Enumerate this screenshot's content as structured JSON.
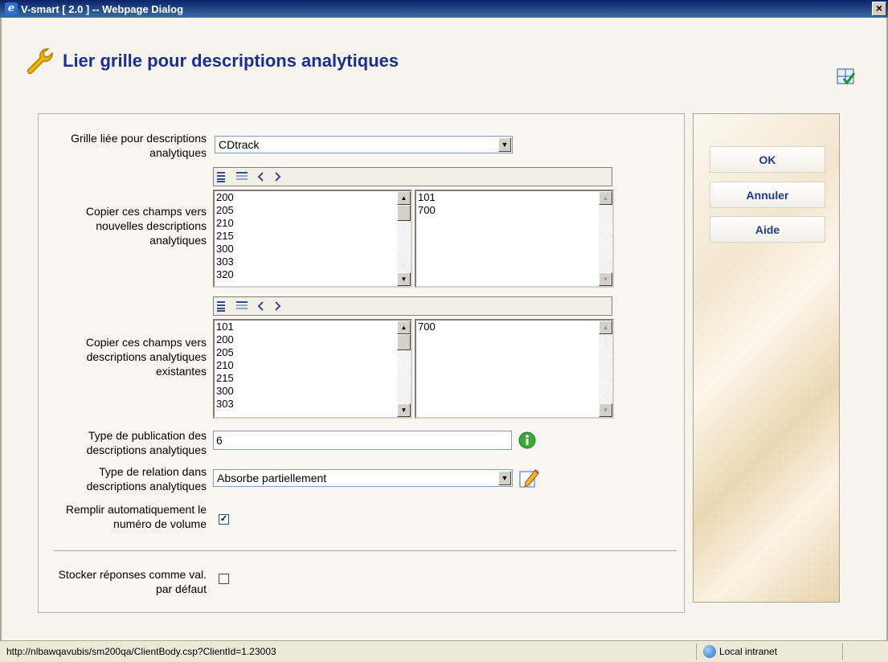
{
  "window": {
    "title": "V-smart [ 2.0 ] -- Webpage Dialog",
    "close_glyph": "×"
  },
  "page": {
    "title": "Lier grille pour descriptions analytiques"
  },
  "form": {
    "linked_grid_label": "Grille liée pour descriptions analytiques",
    "linked_grid_value": "CDtrack",
    "copy_new_label": "Copier ces champs vers nouvelles descriptions analytiques",
    "copy_new_available": [
      "200",
      "205",
      "210",
      "215",
      "300",
      "303",
      "320"
    ],
    "copy_new_selected": [
      "101",
      "700"
    ],
    "copy_existing_label": "Copier ces champs vers descriptions analytiques existantes",
    "copy_existing_available": [
      "101",
      "200",
      "205",
      "210",
      "215",
      "300",
      "303"
    ],
    "copy_existing_selected": [
      "700"
    ],
    "pub_type_label": "Type de publication des descriptions analytiques",
    "pub_type_value": "6",
    "relation_label": "Type de relation dans descriptions analytiques",
    "relation_value": "Absorbe partiellement",
    "auto_volume_label": "Remplir automatiquement le numéro de volume",
    "auto_volume_checked": true,
    "store_default_label": "Stocker réponses comme val. par défaut",
    "store_default_checked": false
  },
  "buttons": {
    "ok": "OK",
    "cancel": "Annuler",
    "help": "Aide"
  },
  "statusbar": {
    "url": "http://nlbawqavubis/sm200qa/ClientBody.csp?ClientId=1.23003",
    "zone": "Local intranet"
  }
}
